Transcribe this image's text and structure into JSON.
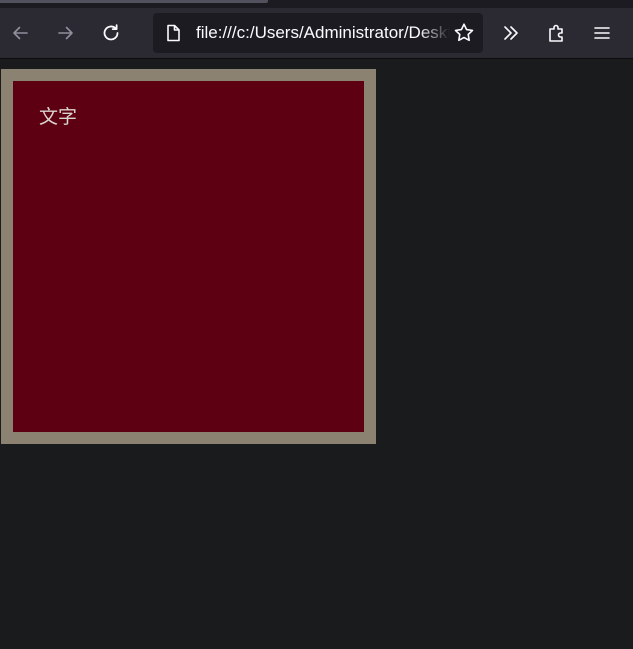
{
  "browser": {
    "url": "file:///c:/Users/Administrator/Desktop/",
    "nav": {
      "back": "arrow-left-icon",
      "forward": "arrow-right-icon",
      "reload": "reload-icon",
      "overflow": "chevrons-right-icon",
      "extensions": "puzzle-icon",
      "menu": "hamburger-menu-icon"
    }
  },
  "page": {
    "box_text": "文字",
    "colors": {
      "box_fill": "#5d0011",
      "box_border": "#8b8271",
      "page_background": "#1a1b1c",
      "text": "#d9d4cf"
    }
  }
}
